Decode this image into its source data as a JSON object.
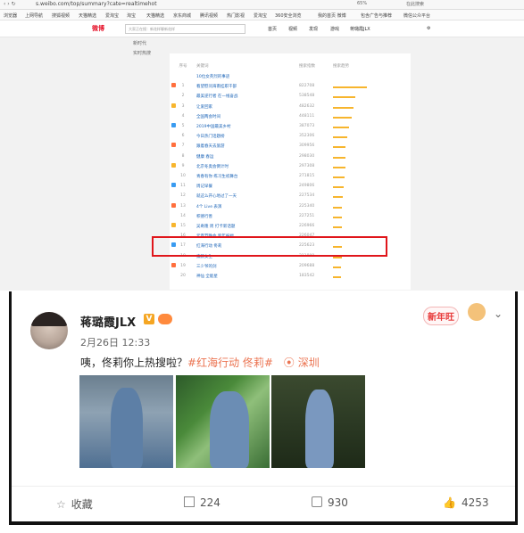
{
  "browser": {
    "url": "s.weibo.com/top/summary?cate=realtimehot",
    "zoom": "65%",
    "search_placeholder": "在此搜索"
  },
  "bookmarks": [
    "浏览器",
    "上网导航",
    "搜狐视频",
    "天猫精选",
    "爱淘宝",
    "淘宝",
    "天猫精选",
    "京东商城",
    "腾讯视频",
    "热门影视",
    "爱淘宝",
    "360安全浏览",
    "我的首页 微博",
    "包含广告与推荐",
    "微信公众平台"
  ],
  "weibo_header": {
    "logo": "微博",
    "search_placeholder": "大家正在搜：新花样聊新花样",
    "nav": [
      "首页",
      "视频",
      "发现",
      "游戏",
      "蒋璐霞JLX",
      "⚙"
    ]
  },
  "left_menu": [
    "新时代",
    "实时热搜"
  ],
  "hot_list": {
    "headers": {
      "rank": "序号",
      "title": "关键词",
      "num": "搜索指数",
      "trend": "搜索趋势"
    },
    "rows": [
      {
        "rank": "",
        "title": "10位女英烈的事迹",
        "num": "",
        "bar": 0
      },
      {
        "rank": "1",
        "title": "看望慰问海南挂职干部",
        "num": "822708",
        "bar": 0.85
      },
      {
        "rank": "2",
        "title": "最美逆行者 在一线奋战",
        "num": "538548",
        "bar": 0.55
      },
      {
        "rank": "3",
        "title": "让爱回家",
        "num": "482632",
        "bar": 0.5
      },
      {
        "rank": "4",
        "title": "全国两会时间",
        "num": "448111",
        "bar": 0.46
      },
      {
        "rank": "5",
        "title": "2019中国最美乡村",
        "num": "387073",
        "bar": 0.4
      },
      {
        "rank": "6",
        "title": "今日热门话题榜",
        "num": "352306",
        "bar": 0.36
      },
      {
        "rank": "7",
        "title": "跟着春天去旅游",
        "num": "309956",
        "bar": 0.32
      },
      {
        "rank": "8",
        "title": "健康 春运",
        "num": "298030",
        "bar": 0.31
      },
      {
        "rank": "9",
        "title": "北京冬奥会倒计时",
        "num": "297308",
        "bar": 0.31
      },
      {
        "rank": "10",
        "title": "青春有你 练习生初舞台",
        "num": "271815",
        "bar": 0.28
      },
      {
        "rank": "11",
        "title": "周记早餐",
        "num": "249806",
        "bar": 0.26
      },
      {
        "rank": "12",
        "title": "就这么开心地过了一天",
        "num": "227534",
        "bar": 0.24
      },
      {
        "rank": "13",
        "title": "4个 Live 表演",
        "num": "225340",
        "bar": 0.23
      },
      {
        "rank": "14",
        "title": "积德行善",
        "num": "227251",
        "bar": 0.23
      },
      {
        "rank": "15",
        "title": "吴奇隆 周 打卡新话题",
        "num": "226966",
        "bar": 0.23
      },
      {
        "rank": "16",
        "title": "元宵节晚会 新年祝福",
        "num": "226047",
        "bar": 0.23
      },
      {
        "rank": "17",
        "title": "红海行动 佟莉",
        "num": "225623",
        "bar": 0.23
      },
      {
        "rank": "18",
        "title": "素颜女生",
        "num": "211809",
        "bar": 0.22
      },
      {
        "rank": "19",
        "title": "三少爷的剑",
        "num": "209688",
        "bar": 0.21
      },
      {
        "rank": "20",
        "title": "神仙 全能星",
        "num": "183542",
        "bar": 0.19
      }
    ]
  },
  "post": {
    "username": "蒋璐霞JLX",
    "verified_badge": "V",
    "time": "2月26日 12:33",
    "text": "咦，佟莉你上热搜啦？",
    "topic": "#红海行动 佟莉#",
    "location": "深圳",
    "sticker_text": "新年旺",
    "actions": {
      "favorite": "收藏",
      "repost": "224",
      "comment": "930",
      "like": "4253"
    }
  },
  "colors": {
    "weibo_red": "#e6162d",
    "topic_orange": "#eb7350",
    "highlight_red": "#e0161b",
    "trend_bar": "#f7b52d"
  }
}
